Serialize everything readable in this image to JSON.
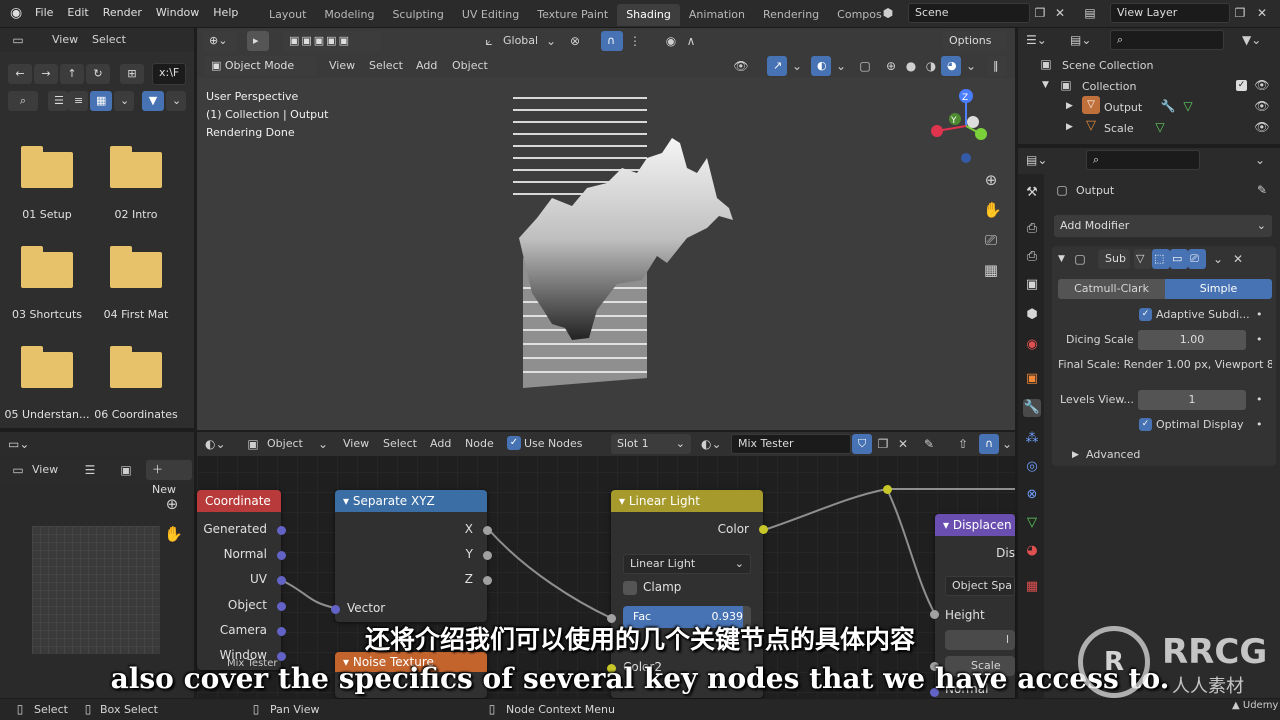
{
  "menubar": {
    "items": [
      "File",
      "Edit",
      "Render",
      "Window",
      "Help"
    ]
  },
  "workspaces": [
    "Layout",
    "Modeling",
    "Sculpting",
    "UV Editing",
    "Texture Paint",
    "Shading",
    "Animation",
    "Rendering",
    "Compos"
  ],
  "scene": {
    "name": "Scene",
    "view_layer": "View Layer"
  },
  "file_browser": {
    "menu": [
      "View",
      "Select"
    ],
    "path": "x:\\F",
    "folders": [
      "01 Setup",
      "02 Intro",
      "03 Shortcuts",
      "04 First Mat",
      "05 Understan...",
      "06 Coordinates"
    ]
  },
  "viewport": {
    "mode": "Object Mode",
    "menu": [
      "View",
      "Select",
      "Add",
      "Object"
    ],
    "transform": "Global",
    "options": "Options",
    "overlay_lines": [
      "User Perspective",
      "(1) Collection | Output",
      "Rendering Done"
    ],
    "gizmo": {
      "z": "Z",
      "y": "Y"
    }
  },
  "image_editor": {
    "view": "View",
    "new": "New"
  },
  "node_editor": {
    "type": "Object",
    "menu": [
      "View",
      "Select",
      "Add",
      "Node"
    ],
    "use_nodes": "Use Nodes",
    "slot": "Slot 1",
    "material": "Mix Tester",
    "nodes": {
      "coordinate": {
        "title": "Coordinate",
        "outputs": [
          "Generated",
          "Normal",
          "UV",
          "Object",
          "Camera",
          "Window"
        ],
        "label_below": "Mix Tester"
      },
      "separate": {
        "title": "Separate XYZ",
        "outputs": [
          "X",
          "Y",
          "Z"
        ],
        "input": "Vector"
      },
      "noise": {
        "title": "Noise Texture"
      },
      "linear": {
        "title": "Linear Light",
        "output": "Color",
        "blend": "Linear Light",
        "clamp": "Clamp",
        "fac_label": "Fac",
        "fac_value": "0.939",
        "color2": "Color2"
      },
      "displacement": {
        "title": "Displacen",
        "dis": "Dis",
        "space": "Object Spa",
        "height": "Height",
        "scale": "Scale",
        "normal": "Normal",
        "mid": "l"
      }
    }
  },
  "outliner": {
    "title": "Scene Collection",
    "items": [
      {
        "label": "Collection"
      },
      {
        "label": "Output"
      },
      {
        "label": "Scale"
      }
    ]
  },
  "properties": {
    "object": "Output",
    "add_modifier": "Add Modifier",
    "modifier_name": "Sub",
    "tabs": [
      "Catmull-Clark",
      "Simple"
    ],
    "adaptive": "Adaptive Subdi...",
    "dicing_label": "Dicing Scale",
    "dicing_value": "1.00",
    "final_scale": "Final Scale: Render 1.00 px, Viewport 8...",
    "levels_label": "Levels View...",
    "levels_value": "1",
    "optimal": "Optimal Display",
    "advanced": "Advanced"
  },
  "statusbar": {
    "items": [
      "Select",
      "Box Select",
      "Pan View",
      "Node Context Menu"
    ]
  },
  "subtitles": {
    "zh": "还将介绍我们可以使用的几个关键节点的具体内容",
    "en": "also cover the specifics of several key nodes that we have access to."
  },
  "watermark": {
    "brand": "RRCG",
    "sub": "人人素材",
    "udemy": "Udemy"
  },
  "colors": {
    "accent": "#4772b3",
    "folder": "#e8c26a",
    "coordinate_header": "#b83a3a",
    "vector_header": "#3a6ea5",
    "color_header": "#a79a2c",
    "disp_header": "#6a4fb0"
  }
}
